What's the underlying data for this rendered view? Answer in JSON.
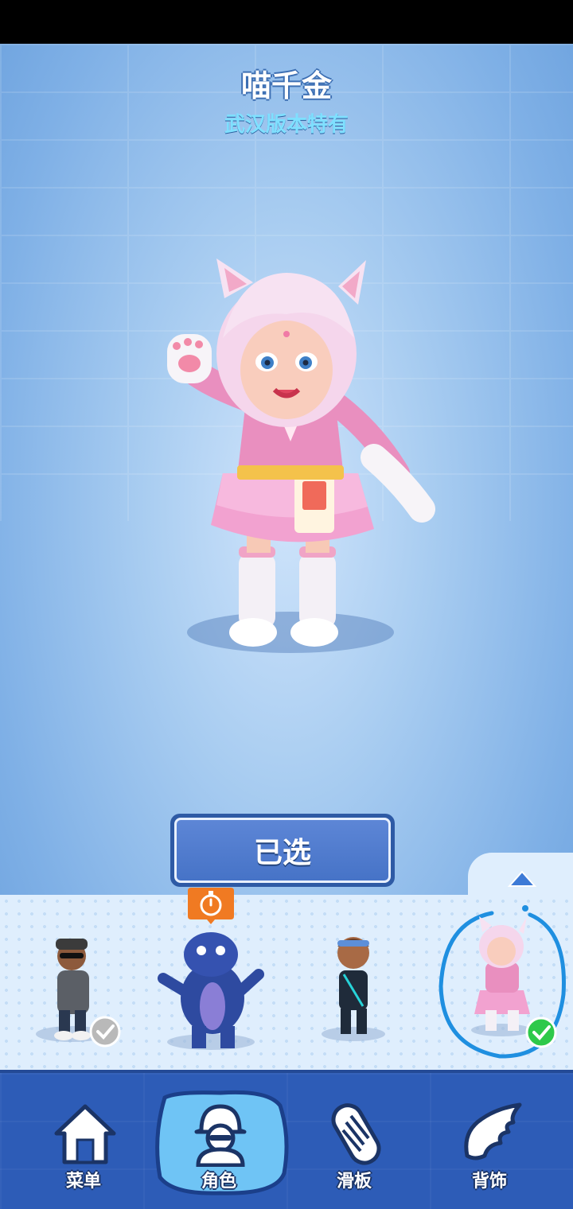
{
  "character": {
    "name": "喵千金",
    "subtitle": "武汉版本特有"
  },
  "select_button": {
    "label": "已选"
  },
  "roster": {
    "slots": [
      {
        "id": "slot-1",
        "owned": true,
        "check_style": "grey"
      },
      {
        "id": "slot-2",
        "owned": false,
        "badge": "timer-icon"
      },
      {
        "id": "slot-3",
        "owned": false
      },
      {
        "id": "slot-4",
        "owned": true,
        "check_style": "green",
        "selected": true
      }
    ]
  },
  "nav": {
    "items": [
      {
        "label": "菜单",
        "icon": "home-icon",
        "active": false
      },
      {
        "label": "角色",
        "icon": "character-icon",
        "active": true
      },
      {
        "label": "滑板",
        "icon": "hoverboard-icon",
        "active": false
      },
      {
        "label": "背饰",
        "icon": "wing-icon",
        "active": false
      }
    ]
  },
  "colors": {
    "accent": "#4673c7",
    "subtitle": "#7fe0ff",
    "nav_bg": "#2d5cb7",
    "check_green": "#2ec94a",
    "timer_orange": "#f07a22"
  }
}
